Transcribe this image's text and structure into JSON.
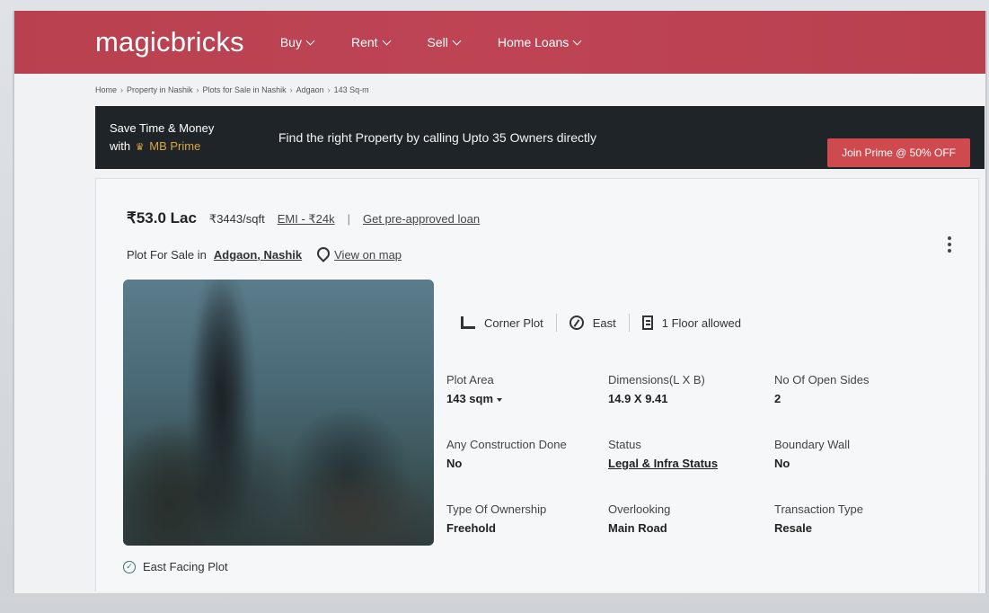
{
  "header": {
    "logo": "magicbricks",
    "nav": [
      {
        "label": "Buy"
      },
      {
        "label": "Rent"
      },
      {
        "label": "Sell"
      },
      {
        "label": "Home Loans"
      }
    ]
  },
  "breadcrumb": [
    "Home",
    "Property in Nashik",
    "Plots for Sale in Nashik",
    "Adgaon",
    "143 Sq-m"
  ],
  "prime": {
    "line1": "Save Time & Money",
    "line2_prefix": "with",
    "line2_brand": "MB Prime",
    "middle": "Find the right Property by calling Upto 35 Owners directly",
    "button": "Join Prime @ 50% OFF"
  },
  "listing": {
    "price": "₹53.0 Lac",
    "rate": "₹3443/sqft",
    "emi": "EMI - ₹24k",
    "loan_link": "Get pre-approved loan",
    "subtitle_prefix": "Plot For Sale in",
    "location": "Adgaon, Nashik",
    "map_link": "View on map",
    "features": [
      {
        "icon": "corner-plot-icon",
        "label": "Corner Plot"
      },
      {
        "icon": "compass-icon",
        "label": "East"
      },
      {
        "icon": "floor-icon",
        "label": "1 Floor allowed"
      }
    ],
    "details": [
      {
        "label": "Plot Area",
        "value": "143 sqm"
      },
      {
        "label": "Dimensions(L X B)",
        "value": "14.9 X 9.41"
      },
      {
        "label": "No Of Open Sides",
        "value": "2"
      },
      {
        "label": "Any Construction Done",
        "value": "No"
      },
      {
        "label": "Status",
        "value": "Legal & Infra Status"
      },
      {
        "label": "Boundary Wall",
        "value": "No"
      },
      {
        "label": "Type Of Ownership",
        "value": "Freehold"
      },
      {
        "label": "Overlooking",
        "value": "Main Road"
      },
      {
        "label": "Transaction Type",
        "value": "Resale"
      }
    ],
    "facing_note": "East Facing Plot"
  }
}
